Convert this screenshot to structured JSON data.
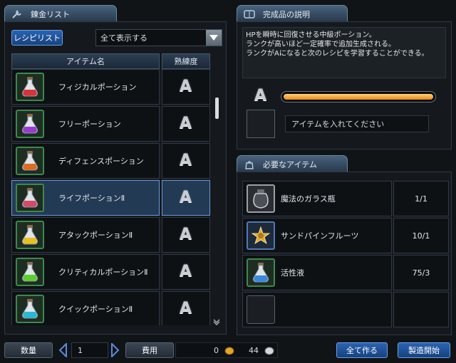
{
  "left_title": "錬金リスト",
  "recipe_button": "レシピリスト",
  "filter": {
    "selected": "全て表示する"
  },
  "columns": {
    "name": "アイテム名",
    "skill": "熟練度"
  },
  "items": [
    {
      "name": "フィジカルポーション",
      "grade": "A",
      "color": "#d8323a"
    },
    {
      "name": "フリーポーション",
      "grade": "A",
      "color": "#9a3bd0"
    },
    {
      "name": "ディフェンスポーション",
      "grade": "A",
      "color": "#e06a22"
    },
    {
      "name": "ライフポーションⅡ",
      "grade": "A",
      "color": "#d44a6a"
    },
    {
      "name": "アタックポーションⅡ",
      "grade": "A",
      "color": "#e8c020"
    },
    {
      "name": "クリティカルポーションⅡ",
      "grade": "A",
      "color": "#5cd02a"
    },
    {
      "name": "クイックポーションⅡ",
      "grade": "A",
      "color": "#28b8d8"
    }
  ],
  "selected_index": 3,
  "result_title": "完成品の説明",
  "description": [
    "HPを瞬時に回復させる中級ポーション。",
    "ランクが高いほど一定確率で追加生成される。",
    "ランクがAになると次のレシピを学習することができる。"
  ],
  "rank": "A",
  "progress": 1.0,
  "insert_prompt": "アイテムを入れてください",
  "required_title": "必要なアイテム",
  "required": [
    {
      "name": "魔法のガラス瓶",
      "count": "1/1",
      "icon": "jar-icon",
      "color": "#c8c8c8"
    },
    {
      "name": "サンドパインフルーツ",
      "count": "10/1",
      "icon": "pine-fruit-icon",
      "color": "#e0a830"
    },
    {
      "name": "活性液",
      "count": "75/3",
      "icon": "flask-icon",
      "color": "#3a88e0"
    },
    {
      "name": "",
      "count": "",
      "icon": "",
      "color": ""
    }
  ],
  "bottom": {
    "quantity_label": "数量",
    "quantity": "1",
    "cost_label": "費用",
    "gold": "0",
    "silver": "44",
    "make_all": "全て作る",
    "start": "製造開始"
  }
}
